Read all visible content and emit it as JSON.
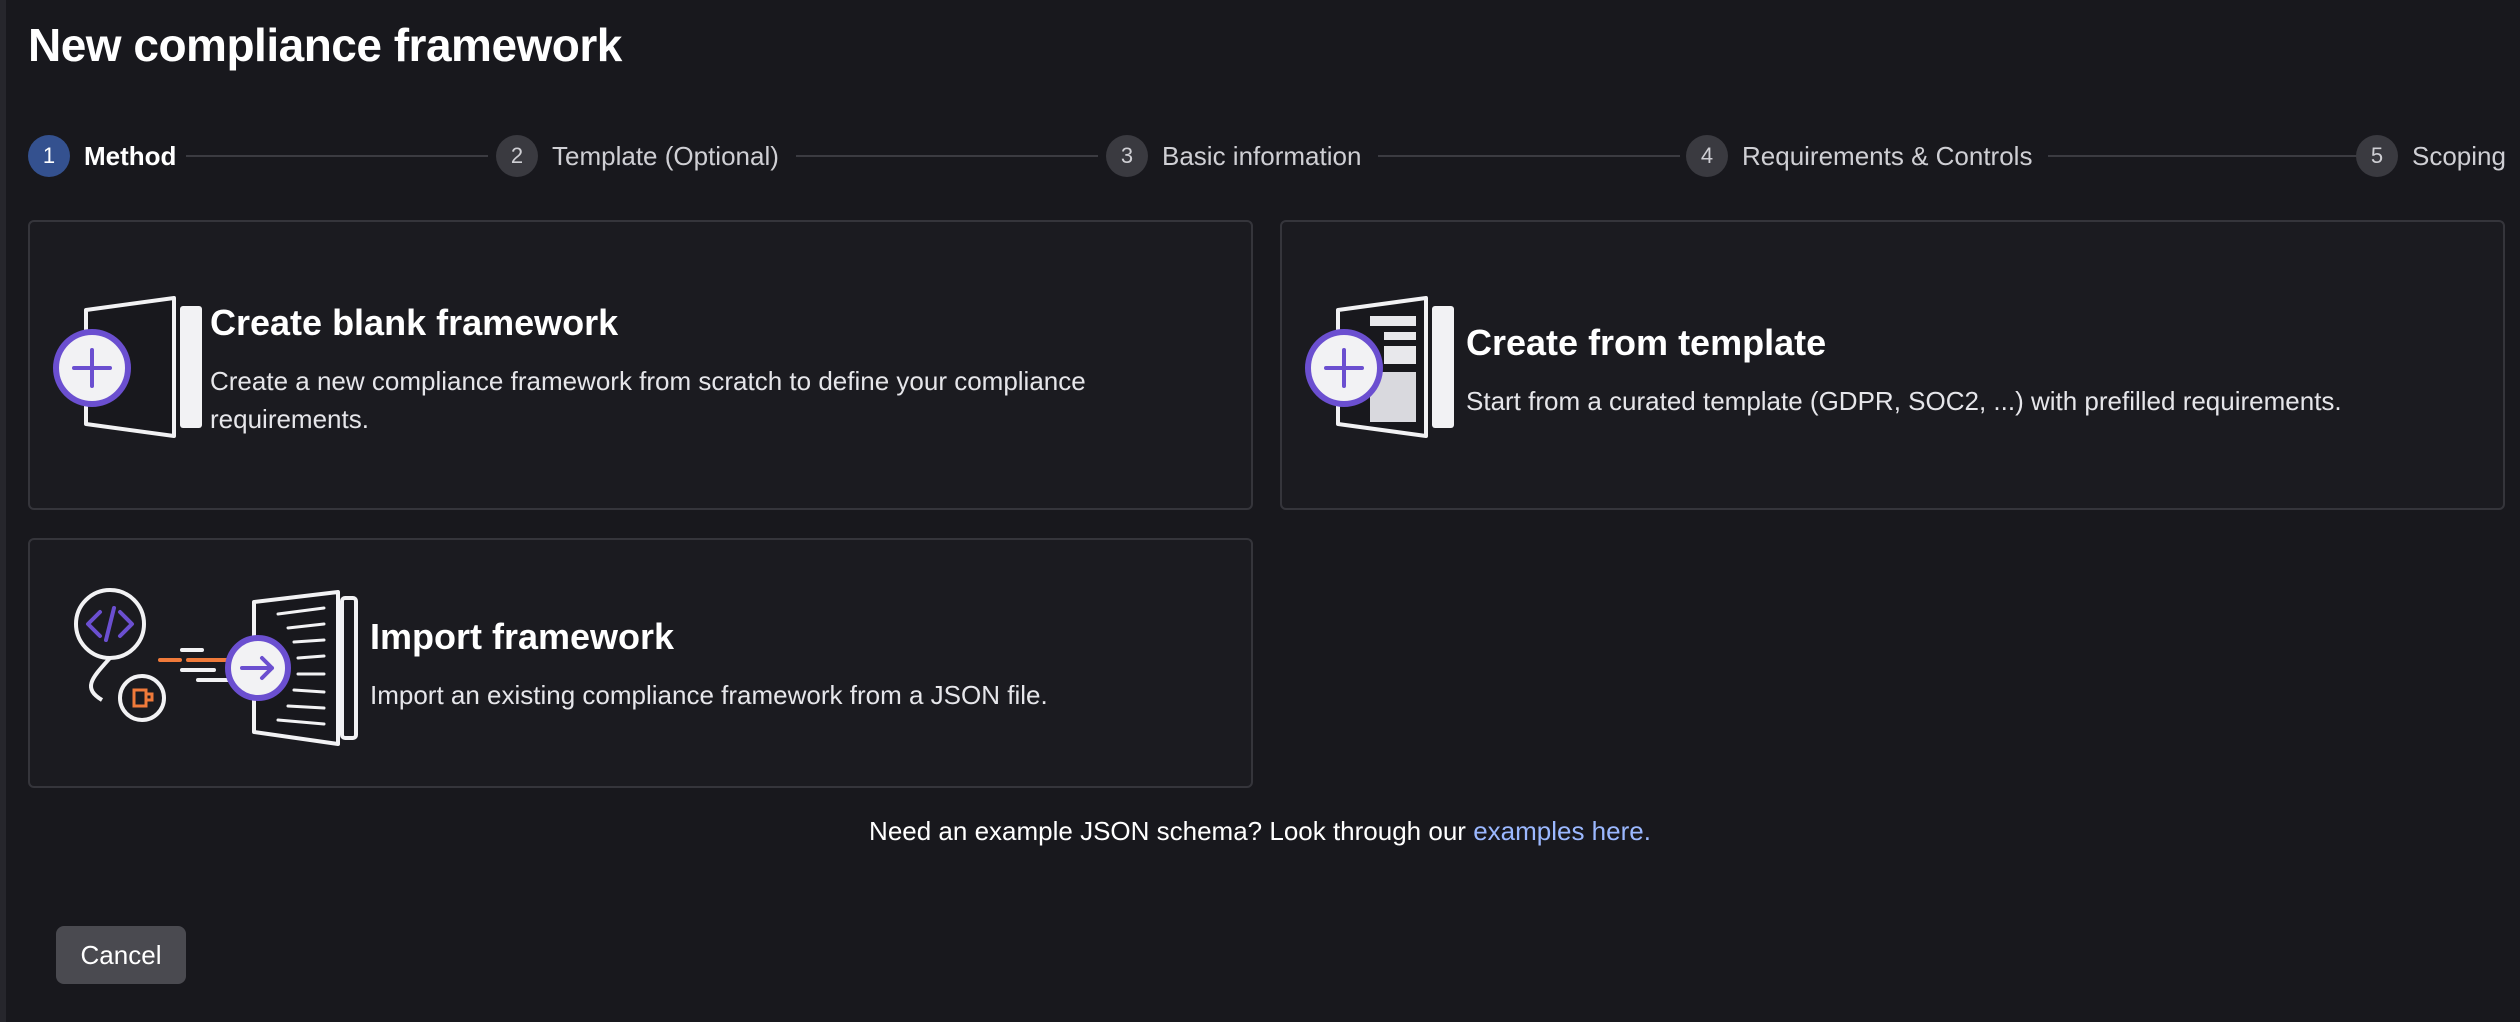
{
  "page": {
    "title": "New compliance framework"
  },
  "stepper": {
    "steps": [
      {
        "number": "1",
        "label": "Method",
        "active": true
      },
      {
        "number": "2",
        "label": "Template (Optional)",
        "active": false
      },
      {
        "number": "3",
        "label": "Basic information",
        "active": false
      },
      {
        "number": "4",
        "label": "Requirements & Controls",
        "active": false
      },
      {
        "number": "5",
        "label": "Scoping",
        "active": false
      }
    ]
  },
  "options": {
    "blank": {
      "title": "Create blank framework",
      "description": "Create a new compliance framework from scratch to define your compliance requirements.",
      "icon": "document-plus-icon"
    },
    "template": {
      "title": "Create from template",
      "description": "Start from a curated template (GDPR, SOC2, ...) with prefilled requirements.",
      "icon": "template-plus-icon"
    },
    "import": {
      "title": "Import framework",
      "description": "Import an existing compliance framework from a JSON file.",
      "icon": "code-import-icon"
    }
  },
  "hint": {
    "text": "Need an example JSON schema? Look through our",
    "link_text": "examples here."
  },
  "footer": {
    "cancel_label": "Cancel"
  },
  "colors": {
    "background": "#18181d",
    "accent_purple": "#6b4fd0",
    "accent_orange": "#f07a3a",
    "link": "#9bb8ff",
    "active_step": "#34518f"
  }
}
